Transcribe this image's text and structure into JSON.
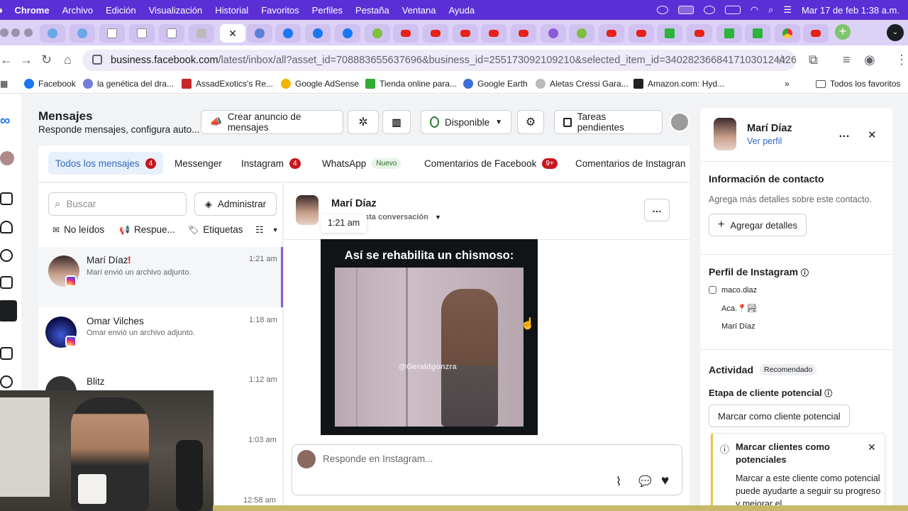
{
  "menubar": {
    "app": "Chrome",
    "items": [
      "Archivo",
      "Edición",
      "Visualización",
      "Historial",
      "Favoritos",
      "Perfiles",
      "Pestaña",
      "Ventana",
      "Ayuda"
    ],
    "clock": "Mar 17 de feb  1:38 a.m."
  },
  "browser": {
    "url_domain": "business.facebook.com",
    "url_path": "/latest/inbox/all?asset_id=708883655637696&business_id=255173092109210&selected_item_id=3402823668417103012442​60...",
    "bookmarks": [
      "Facebook",
      "la genética del dra...",
      "AssadExotics's Re...",
      "Google AdSense",
      "Tienda online para...",
      "Google Earth",
      "Aletas Cressi Gara...",
      "Amazon.com: Hyd..."
    ],
    "all_bookmarks": "Todos los favoritos"
  },
  "header": {
    "title": "Mensajes",
    "subtitle": "Responde mensajes, configura auto...",
    "create_ad": "Crear anuncio de mensajes",
    "status": "Disponible",
    "pending": "Tareas pendientes"
  },
  "tabs": {
    "all": "Todos los mensajes",
    "all_badge": "4",
    "messenger": "Messenger",
    "instagram": "Instagram",
    "instagram_badge": "4",
    "whatsapp": "WhatsApp",
    "whatsapp_badge": "Nuevo",
    "fb_comments": "Comentarios de Facebook",
    "fb_comments_badge": "9+",
    "ig_comments": "Comentarios de Instagran"
  },
  "list": {
    "search_placeholder": "Buscar",
    "manage": "Administrar",
    "unread": "No leídos",
    "replies": "Respue...",
    "labels": "Etiquetas",
    "conversations": [
      {
        "name": "Marí Díaz",
        "preview": "Marí envió un archivo adjunto.",
        "time": "1:21 am"
      },
      {
        "name": "Omar Vilches",
        "preview": "Omar envió un archivo adjunto.",
        "time": "1:18 am"
      },
      {
        "name": "Blitz",
        "preview": "",
        "time": "1:12 am"
      },
      {
        "name": "",
        "preview": "",
        "time": "1:03 am"
      },
      {
        "name": "",
        "preview": "",
        "time": "12:58 am"
      }
    ]
  },
  "chat": {
    "contact": "Marí Díaz",
    "sub": "sta conversación",
    "tooltip": "1:21 am",
    "video_caption": "Así se rehabilita un chismoso:",
    "watermark": "@Geraldgonzra",
    "composer_placeholder": "Responde en Instagram..."
  },
  "right": {
    "name": "Marí Díaz",
    "view_profile": "Ver perfil",
    "contact_info": "Información de contacto",
    "contact_hint": "Agrega más detalles sobre este contacto.",
    "add_details": "Agregar detalles",
    "ig_profile": "Perfil de Instagram",
    "ig_handle": "maco.diaz",
    "ig_bio": "Aca.📍🏞",
    "ig_name": "Marí Díaz",
    "activity": "Actividad",
    "recommended": "Recomendado",
    "stage": "Etapa de cliente potencial",
    "mark_lead": "Marcar como cliente potencial",
    "tip_title": "Marcar clientes como potenciales",
    "tip_body": "Marcar a este cliente como potencial puede ayudarte a seguir su progreso y mejorar el"
  }
}
